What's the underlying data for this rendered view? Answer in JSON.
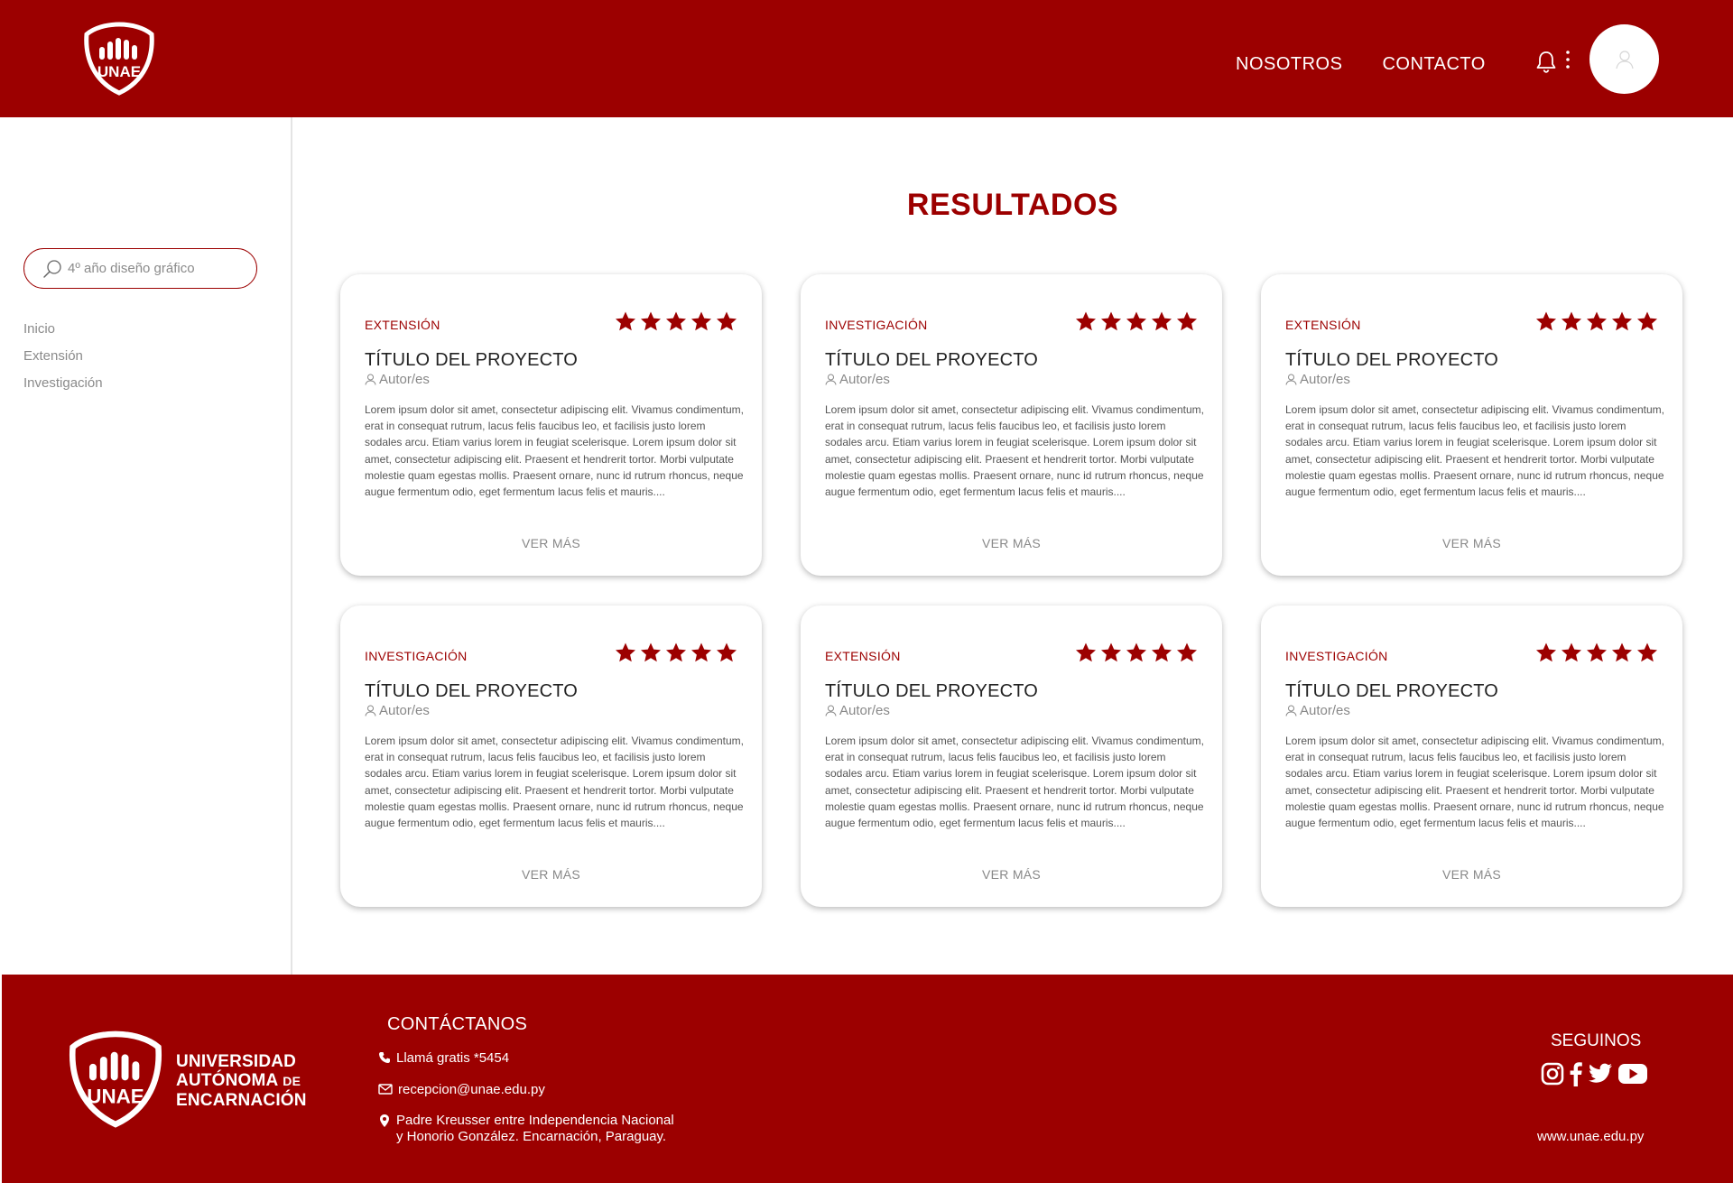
{
  "header": {
    "logo_text": "UNAE",
    "nav": [
      "NOSOTROS",
      "CONTACTO"
    ]
  },
  "sidebar": {
    "search_placeholder": "4º año diseño gráfico",
    "links": [
      "Inicio",
      "Extensión",
      "Investigación"
    ]
  },
  "main": {
    "title": "RESULTADOS",
    "cards": [
      {
        "category": "EXTENSIÓN",
        "rating": 5,
        "title": "TÍTULO DEL PROYECTO",
        "author": "Autor/es",
        "description": "Lorem ipsum dolor sit amet, consectetur adipiscing elit. Vivamus condimentum, erat in consequat rutrum, lacus felis faucibus leo, et facilisis justo lorem sodales arcu. Etiam varius lorem in feugiat scelerisque. Lorem ipsum dolor sit amet, consectetur adipiscing elit. Praesent et hendrerit tortor. Morbi vulputate molestie quam egestas mollis. Praesent ornare, nunc id rutrum rhoncus, neque augue fermentum odio, eget fermentum lacus felis et mauris....",
        "more": "VER MÁS"
      },
      {
        "category": "INVESTIGACIÓN",
        "rating": 5,
        "title": "TÍTULO DEL PROYECTO",
        "author": "Autor/es",
        "description": "Lorem ipsum dolor sit amet, consectetur adipiscing elit. Vivamus condimentum, erat in consequat rutrum, lacus felis faucibus leo, et facilisis justo lorem sodales arcu. Etiam varius lorem in feugiat scelerisque. Lorem ipsum dolor sit amet, consectetur adipiscing elit. Praesent et hendrerit tortor. Morbi vulputate molestie quam egestas mollis. Praesent ornare, nunc id rutrum rhoncus, neque augue fermentum odio, eget fermentum lacus felis et mauris....",
        "more": "VER MÁS"
      },
      {
        "category": "EXTENSIÓN",
        "rating": 5,
        "title": "TÍTULO DEL PROYECTO",
        "author": "Autor/es",
        "description": "Lorem ipsum dolor sit amet, consectetur adipiscing elit. Vivamus condimentum, erat in consequat rutrum, lacus felis faucibus leo, et facilisis justo lorem sodales arcu. Etiam varius lorem in feugiat scelerisque. Lorem ipsum dolor sit amet, consectetur adipiscing elit. Praesent et hendrerit tortor. Morbi vulputate molestie quam egestas mollis. Praesent ornare, nunc id rutrum rhoncus, neque augue fermentum odio, eget fermentum lacus felis et mauris....",
        "more": "VER MÁS"
      },
      {
        "category": "INVESTIGACIÓN",
        "rating": 5,
        "title": "TÍTULO DEL PROYECTO",
        "author": "Autor/es",
        "description": "Lorem ipsum dolor sit amet, consectetur adipiscing elit. Vivamus condimentum, erat in consequat rutrum, lacus felis faucibus leo, et facilisis justo lorem sodales arcu. Etiam varius lorem in feugiat scelerisque. Lorem ipsum dolor sit amet, consectetur adipiscing elit. Praesent et hendrerit tortor. Morbi vulputate molestie quam egestas mollis. Praesent ornare, nunc id rutrum rhoncus, neque augue fermentum odio, eget fermentum lacus felis et mauris....",
        "more": "VER MÁS"
      },
      {
        "category": "EXTENSIÓN",
        "rating": 5,
        "title": "TÍTULO DEL PROYECTO",
        "author": "Autor/es",
        "description": "Lorem ipsum dolor sit amet, consectetur adipiscing elit. Vivamus condimentum, erat in consequat rutrum, lacus felis faucibus leo, et facilisis justo lorem sodales arcu. Etiam varius lorem in feugiat scelerisque. Lorem ipsum dolor sit amet, consectetur adipiscing elit. Praesent et hendrerit tortor. Morbi vulputate molestie quam egestas mollis. Praesent ornare, nunc id rutrum rhoncus, neque augue fermentum odio, eget fermentum lacus felis et mauris....",
        "more": "VER MÁS"
      },
      {
        "category": "INVESTIGACIÓN",
        "rating": 5,
        "title": "TÍTULO DEL PROYECTO",
        "author": "Autor/es",
        "description": "Lorem ipsum dolor sit amet, consectetur adipiscing elit. Vivamus condimentum, erat in consequat rutrum, lacus felis faucibus leo, et facilisis justo lorem sodales arcu. Etiam varius lorem in feugiat scelerisque. Lorem ipsum dolor sit amet, consectetur adipiscing elit. Praesent et hendrerit tortor. Morbi vulputate molestie quam egestas mollis. Praesent ornare, nunc id rutrum rhoncus, neque augue fermentum odio, eget fermentum lacus felis et mauris....",
        "more": "VER MÁS"
      }
    ]
  },
  "footer": {
    "logo_text": "UNAE",
    "university_line1": "UNIVERSIDAD",
    "university_line2a": "AUTÓNOMA",
    "university_line2b": "DE",
    "university_line3": "ENCARNACIÓN",
    "contact_title": "CONTÁCTANOS",
    "phone": "Llamá gratis *5454",
    "email": "recepcion@unae.edu.py",
    "address_line1": "Padre Kreusser entre Independencia Nacional",
    "address_line2": "y Honorio González. Encarnación, Paraguay.",
    "social_title": "SEGUINOS",
    "social_icons": [
      "instagram-icon",
      "facebook-icon",
      "twitter-icon",
      "youtube-icon"
    ],
    "website": "www.unae.edu.py"
  },
  "colors": {
    "brand": "#9c0000",
    "background": "#ffffff",
    "muted_text": "#888888"
  },
  "icons": [
    "unae-logo",
    "bell-icon",
    "kebab-menu-icon",
    "user-icon",
    "search-icon",
    "star-icon",
    "person-icon",
    "phone-icon",
    "mail-icon",
    "location-pin-icon"
  ]
}
